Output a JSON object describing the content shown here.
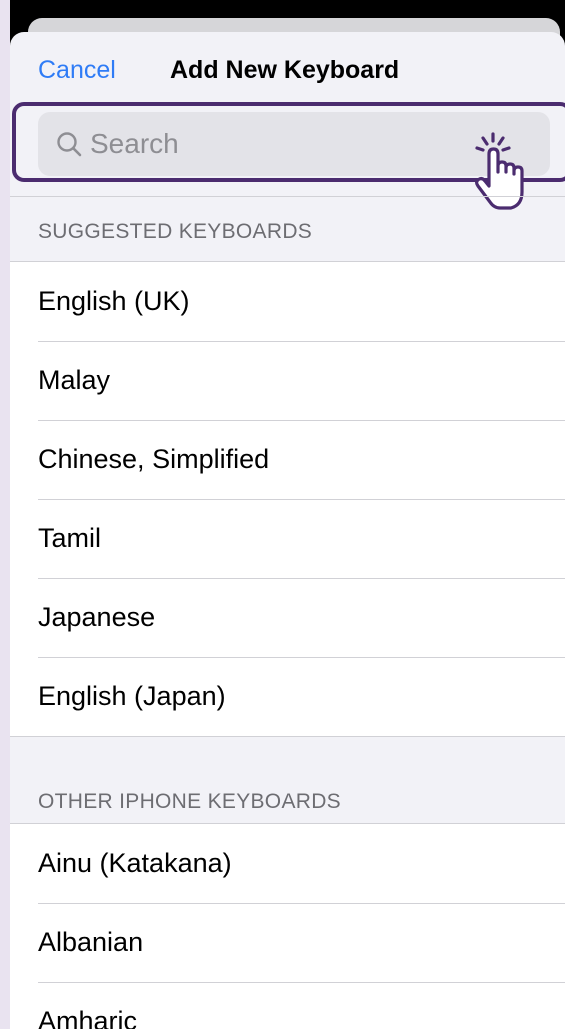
{
  "navbar": {
    "cancel_label": "Cancel",
    "title": "Add New Keyboard"
  },
  "search": {
    "placeholder": "Search",
    "icon": "magnifying-glass-icon"
  },
  "annotation": {
    "icon": "tap-hand-icon",
    "accent_color": "#4b2c6f"
  },
  "suggested": {
    "header": "SUGGESTED KEYBOARDS",
    "items": [
      {
        "label": "English (UK)"
      },
      {
        "label": "Malay"
      },
      {
        "label": "Chinese, Simplified"
      },
      {
        "label": "Tamil"
      },
      {
        "label": "Japanese"
      },
      {
        "label": "English (Japan)"
      }
    ]
  },
  "other": {
    "header": "OTHER IPHONE KEYBOARDS",
    "items": [
      {
        "label": "Ainu (Katakana)"
      },
      {
        "label": "Albanian"
      },
      {
        "label": "Amharic"
      }
    ]
  },
  "colors": {
    "link": "#2f7cf6",
    "background": "#f2f2f7"
  }
}
